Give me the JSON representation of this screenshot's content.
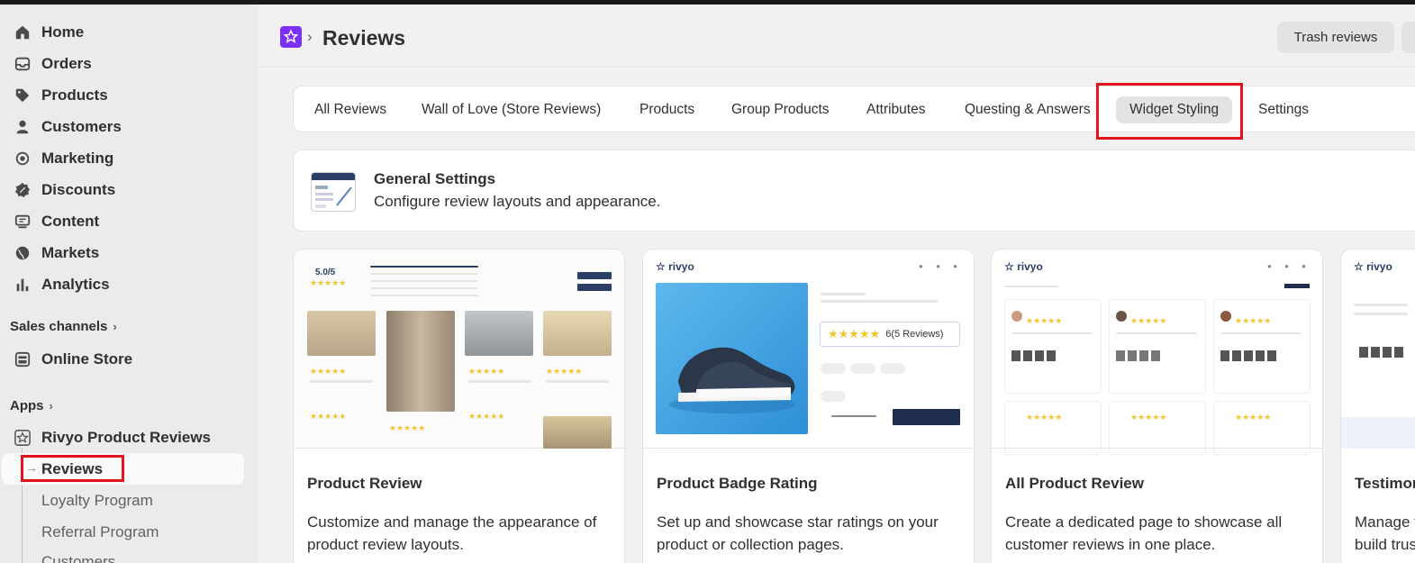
{
  "sidebar": {
    "nav": [
      {
        "label": "Home",
        "icon": "home-icon"
      },
      {
        "label": "Orders",
        "icon": "inbox-icon"
      },
      {
        "label": "Products",
        "icon": "tag-icon"
      },
      {
        "label": "Customers",
        "icon": "person-icon"
      },
      {
        "label": "Marketing",
        "icon": "target-icon"
      },
      {
        "label": "Discounts",
        "icon": "discount-icon"
      },
      {
        "label": "Content",
        "icon": "content-icon"
      },
      {
        "label": "Markets",
        "icon": "globe-icon"
      },
      {
        "label": "Analytics",
        "icon": "bar-chart-icon"
      }
    ],
    "sales_channels": "Sales channels",
    "online_store": "Online Store",
    "apps": "Apps",
    "app_name": "Rivyo Product Reviews",
    "sub_items": [
      "Reviews",
      "Loyalty Program",
      "Referral Program",
      "Customers"
    ]
  },
  "header": {
    "title": "Reviews",
    "trash_button": "Trash reviews"
  },
  "tabs": [
    "All Reviews",
    "Wall of Love (Store Reviews)",
    "Products",
    "Group Products",
    "Attributes",
    "Questing & Answers",
    "Widget Styling",
    "Settings"
  ],
  "general": {
    "title": "General Settings",
    "subtitle": "Configure review layouts and appearance."
  },
  "cards": [
    {
      "title": "Product Review",
      "desc": "Customize and manage the appearance of product review layouts."
    },
    {
      "title": "Product Badge Rating",
      "desc": "Set up and showcase star ratings on your product or collection pages."
    },
    {
      "title": "All Product Review",
      "desc": "Create a dedicated page to showcase all customer reviews in one place."
    },
    {
      "title": "Testimonials",
      "desc": "Manage testimonials to build trust."
    }
  ],
  "preview": {
    "brand": "rivyo",
    "rating": "5.0/5",
    "badge_text": "6(5 Reviews)"
  },
  "colors": {
    "accent": "#7b2ff7",
    "highlight": "#e3141c",
    "brand_navy": "#2c3e66",
    "star": "#f4c430"
  }
}
